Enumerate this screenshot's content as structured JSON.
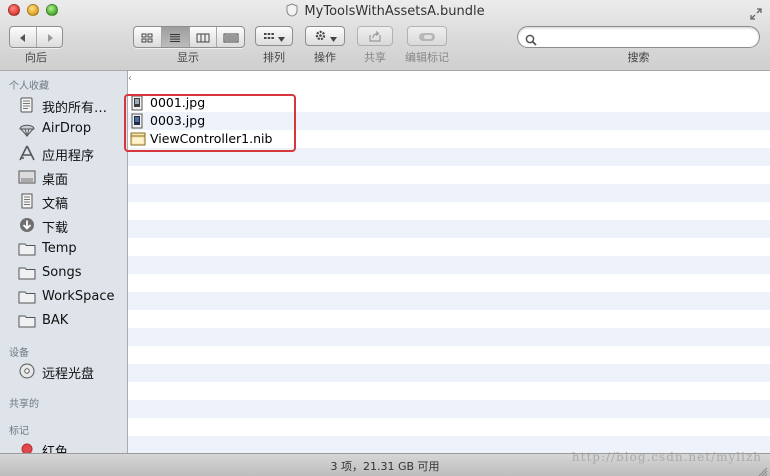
{
  "window": {
    "title": "MyToolsWithAssetsA.bundle"
  },
  "toolbar": {
    "back_forward_label": "向后",
    "view_label": "显示",
    "arrange_label": "排列",
    "action_label": "操作",
    "share_label": "共享",
    "tags_label": "编辑标记",
    "search_label": "搜索",
    "search_value": "",
    "search_placeholder": ""
  },
  "sidebar": {
    "favorites_header": "个人收藏",
    "favorites": [
      {
        "label": "我的所有…",
        "icon": "all-files-icon"
      },
      {
        "label": "AirDrop",
        "icon": "airdrop-icon"
      },
      {
        "label": "应用程序",
        "icon": "applications-icon"
      },
      {
        "label": "桌面",
        "icon": "desktop-icon"
      },
      {
        "label": "文稿",
        "icon": "documents-icon"
      },
      {
        "label": "下载",
        "icon": "downloads-icon"
      },
      {
        "label": "Temp",
        "icon": "folder-icon"
      },
      {
        "label": "Songs",
        "icon": "folder-icon"
      },
      {
        "label": "WorkSpace",
        "icon": "folder-icon"
      },
      {
        "label": "BAK",
        "icon": "folder-icon"
      }
    ],
    "devices_header": "设备",
    "devices": [
      {
        "label": "远程光盘",
        "icon": "disc-icon"
      }
    ],
    "shared_header": "共享的",
    "tags_header": "标记",
    "tags": [
      {
        "label": "红色",
        "color": "#e2474b"
      }
    ]
  },
  "files": [
    {
      "name": "0001.jpg",
      "icon": "jpg-file-icon"
    },
    {
      "name": "0003.jpg",
      "icon": "jpg-file-icon"
    },
    {
      "name": "ViewController1.nib",
      "icon": "nib-file-icon"
    }
  ],
  "status": {
    "text": "3 项，21.31 GB 可用"
  },
  "watermark": "http://blog.csdn.net/mylizh",
  "colors": {
    "highlight": "#d7363c",
    "row_alt": "#eef3fb",
    "sidebar_bg": "#dee4ea"
  }
}
